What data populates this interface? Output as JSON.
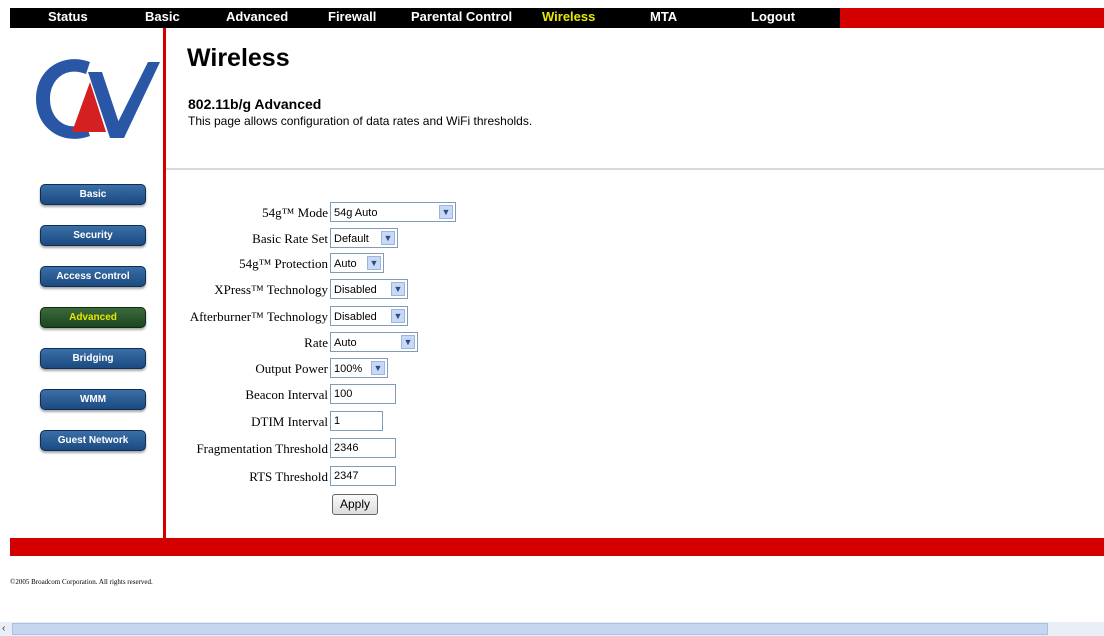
{
  "nav": {
    "items": [
      {
        "label": "Status"
      },
      {
        "label": "Basic"
      },
      {
        "label": "Advanced"
      },
      {
        "label": "Firewall"
      },
      {
        "label": "Parental Control"
      },
      {
        "label": "Wireless"
      },
      {
        "label": "MTA"
      },
      {
        "label": "Logout"
      }
    ],
    "active": "Wireless"
  },
  "sidebar": {
    "items": [
      {
        "label": "Basic"
      },
      {
        "label": "Security"
      },
      {
        "label": "Access Control"
      },
      {
        "label": "Advanced"
      },
      {
        "label": "Bridging"
      },
      {
        "label": "WMM"
      },
      {
        "label": "Guest Network"
      }
    ],
    "active": "Advanced"
  },
  "header": {
    "title": "Wireless",
    "subtitle": "802.11b/g Advanced",
    "description": "This page allows configuration of data rates and WiFi thresholds."
  },
  "form": {
    "mode_label": "54g™ Mode",
    "mode_value": "54g Auto",
    "basic_rate_label": "Basic Rate Set",
    "basic_rate_value": "Default",
    "protection_label": "54g™ Protection",
    "protection_value": "Auto",
    "xpress_label": "XPress™ Technology",
    "xpress_value": "Disabled",
    "afterburner_label": "Afterburner™ Technology",
    "afterburner_value": "Disabled",
    "rate_label": "Rate",
    "rate_value": "Auto",
    "output_power_label": "Output Power",
    "output_power_value": "100%",
    "beacon_label": "Beacon Interval",
    "beacon_value": "100",
    "dtim_label": "DTIM Interval",
    "dtim_value": "1",
    "frag_label": "Fragmentation Threshold",
    "frag_value": "2346",
    "rts_label": "RTS Threshold",
    "rts_value": "2347",
    "apply_label": "Apply"
  },
  "footer": {
    "copyright": "©2005 Broadcom Corporation. All rights reserved."
  },
  "colors": {
    "accent_red": "#d40000",
    "nav_black": "#000000",
    "active_yellow": "#e8e800",
    "button_blue": "#1b4a80",
    "button_green": "#1d4620"
  }
}
